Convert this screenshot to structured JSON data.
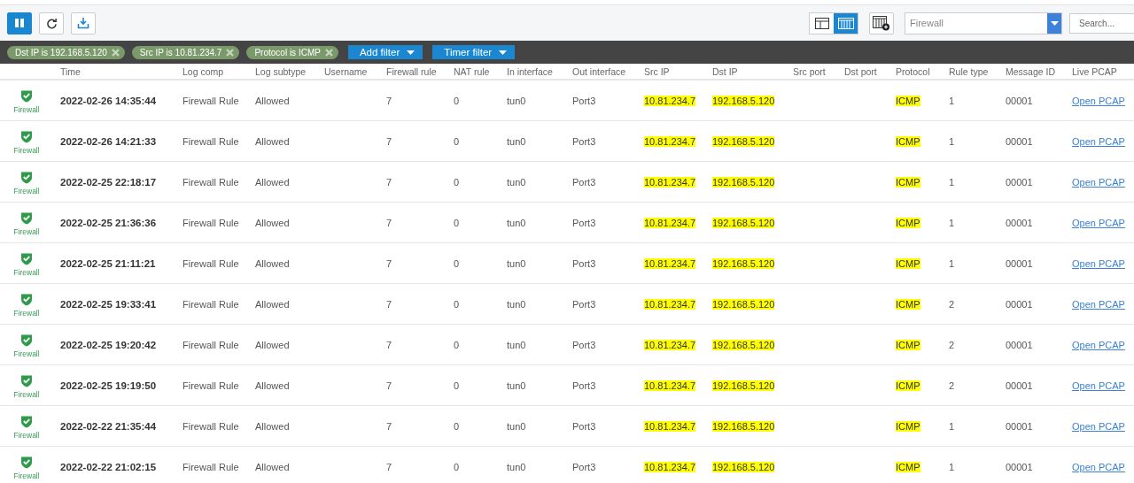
{
  "toolbar": {
    "view_modes": [
      {
        "kind": "split",
        "selected": false
      },
      {
        "kind": "grid",
        "selected": true
      }
    ],
    "log_type": "Firewall",
    "search": {
      "placeholder": "Search..."
    }
  },
  "filters": [
    {
      "label": "Dst IP is 192.168.5.120"
    },
    {
      "label": "Src IP is 10.81.234.7"
    },
    {
      "label": "Protocol is ICMP"
    }
  ],
  "filter_menus": [
    "Add filter",
    "Timer filter"
  ],
  "table": {
    "columns": [
      "Time",
      "Log comp",
      "Log subtype",
      "Username",
      "Firewall rule",
      "NAT rule",
      "In interface",
      "Out interface",
      "Src IP",
      "Dst IP",
      "Src port",
      "Dst port",
      "Protocol",
      "Rule type",
      "Message ID",
      "Live PCAP"
    ],
    "rows": [
      {
        "module": "Firewall",
        "time": "2022-02-26 14:35:44",
        "log_comp": "Firewall Rule",
        "log_subtype": "Allowed",
        "firewall_rule": "7",
        "nat_rule": "0",
        "in_interface": "tun0",
        "out_interface": "Port3",
        "src_ip": "10.81.234.7",
        "dst_ip": "192.168.5.120",
        "protocol": "ICMP",
        "rule_type": "1",
        "message_id": "00001",
        "live_pcap": "Open PCAP"
      },
      {
        "module": "Firewall",
        "time": "2022-02-26 14:21:33",
        "log_comp": "Firewall Rule",
        "log_subtype": "Allowed",
        "firewall_rule": "7",
        "nat_rule": "0",
        "in_interface": "tun0",
        "out_interface": "Port3",
        "src_ip": "10.81.234.7",
        "dst_ip": "192.168.5.120",
        "protocol": "ICMP",
        "rule_type": "1",
        "message_id": "00001",
        "live_pcap": "Open PCAP"
      },
      {
        "module": "Firewall",
        "time": "2022-02-25 22:18:17",
        "log_comp": "Firewall Rule",
        "log_subtype": "Allowed",
        "firewall_rule": "7",
        "nat_rule": "0",
        "in_interface": "tun0",
        "out_interface": "Port3",
        "src_ip": "10.81.234.7",
        "dst_ip": "192.168.5.120",
        "protocol": "ICMP",
        "rule_type": "1",
        "message_id": "00001",
        "live_pcap": "Open PCAP"
      },
      {
        "module": "Firewall",
        "time": "2022-02-25 21:36:36",
        "log_comp": "Firewall Rule",
        "log_subtype": "Allowed",
        "firewall_rule": "7",
        "nat_rule": "0",
        "in_interface": "tun0",
        "out_interface": "Port3",
        "src_ip": "10.81.234.7",
        "dst_ip": "192.168.5.120",
        "protocol": "ICMP",
        "rule_type": "1",
        "message_id": "00001",
        "live_pcap": "Open PCAP"
      },
      {
        "module": "Firewall",
        "time": "2022-02-25 21:11:21",
        "log_comp": "Firewall Rule",
        "log_subtype": "Allowed",
        "firewall_rule": "7",
        "nat_rule": "0",
        "in_interface": "tun0",
        "out_interface": "Port3",
        "src_ip": "10.81.234.7",
        "dst_ip": "192.168.5.120",
        "protocol": "ICMP",
        "rule_type": "1",
        "message_id": "00001",
        "live_pcap": "Open PCAP"
      },
      {
        "module": "Firewall",
        "time": "2022-02-25 19:33:41",
        "log_comp": "Firewall Rule",
        "log_subtype": "Allowed",
        "firewall_rule": "7",
        "nat_rule": "0",
        "in_interface": "tun0",
        "out_interface": "Port3",
        "src_ip": "10.81.234.7",
        "dst_ip": "192.168.5.120",
        "protocol": "ICMP",
        "rule_type": "2",
        "message_id": "00001",
        "live_pcap": "Open PCAP"
      },
      {
        "module": "Firewall",
        "time": "2022-02-25 19:20:42",
        "log_comp": "Firewall Rule",
        "log_subtype": "Allowed",
        "firewall_rule": "7",
        "nat_rule": "0",
        "in_interface": "tun0",
        "out_interface": "Port3",
        "src_ip": "10.81.234.7",
        "dst_ip": "192.168.5.120",
        "protocol": "ICMP",
        "rule_type": "2",
        "message_id": "00001",
        "live_pcap": "Open PCAP"
      },
      {
        "module": "Firewall",
        "time": "2022-02-25 19:19:50",
        "log_comp": "Firewall Rule",
        "log_subtype": "Allowed",
        "firewall_rule": "7",
        "nat_rule": "0",
        "in_interface": "tun0",
        "out_interface": "Port3",
        "src_ip": "10.81.234.7",
        "dst_ip": "192.168.5.120",
        "protocol": "ICMP",
        "rule_type": "2",
        "message_id": "00001",
        "live_pcap": "Open PCAP"
      },
      {
        "module": "Firewall",
        "time": "2022-02-22 21:35:44",
        "log_comp": "Firewall Rule",
        "log_subtype": "Allowed",
        "firewall_rule": "7",
        "nat_rule": "0",
        "in_interface": "tun0",
        "out_interface": "Port3",
        "src_ip": "10.81.234.7",
        "dst_ip": "192.168.5.120",
        "protocol": "ICMP",
        "rule_type": "1",
        "message_id": "00001",
        "live_pcap": "Open PCAP"
      },
      {
        "module": "Firewall",
        "time": "2022-02-22 21:02:15",
        "log_comp": "Firewall Rule",
        "log_subtype": "Allowed",
        "firewall_rule": "7",
        "nat_rule": "0",
        "in_interface": "tun0",
        "out_interface": "Port3",
        "src_ip": "10.81.234.7",
        "dst_ip": "192.168.5.120",
        "protocol": "ICMP",
        "rule_type": "1",
        "message_id": "00001",
        "live_pcap": "Open PCAP"
      }
    ]
  }
}
